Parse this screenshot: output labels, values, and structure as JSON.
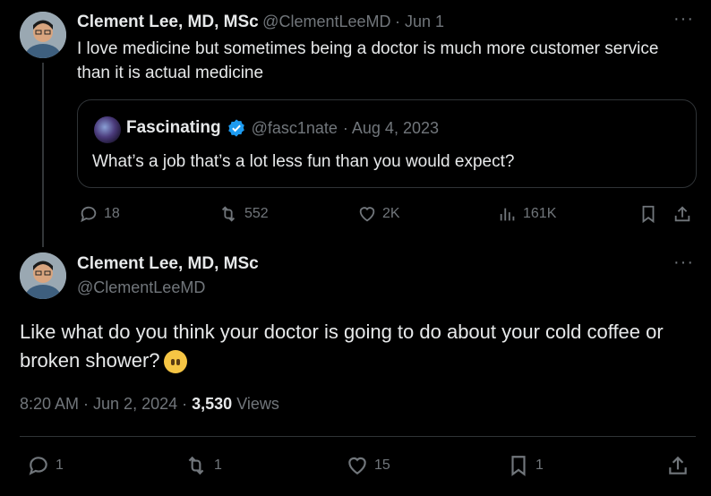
{
  "parent_tweet": {
    "author_name": "Clement Lee, MD, MSc",
    "handle": "@ClementLeeMD",
    "date": "· Jun 1",
    "text": "I love medicine but sometimes being a doctor is much more customer service than it is actual medicine",
    "quote": {
      "author_name": "Fascinating",
      "handle": "@fasc1nate",
      "date": "· Aug 4, 2023",
      "text": "What’s a job that’s a lot less fun than you would expect?"
    },
    "actions": {
      "replies": "18",
      "reposts": "552",
      "likes": "2K",
      "views": "161K"
    }
  },
  "main_tweet": {
    "author_name": "Clement Lee, MD, MSc",
    "handle": "@ClementLeeMD",
    "text": "Like what do you think your doctor is going to do about your cold coffee or broken shower?",
    "timestamp": "8:20 AM · Jun 2, 2024 ·",
    "views_count": "3,530",
    "views_label": "Views",
    "actions": {
      "replies": "1",
      "reposts": "1",
      "likes": "15",
      "bookmarks": "1"
    }
  },
  "more_label": "···",
  "colors": {
    "background": "#000000",
    "text": "#e7e9ea",
    "muted": "#71767b",
    "verified": "#1d9bf0"
  }
}
